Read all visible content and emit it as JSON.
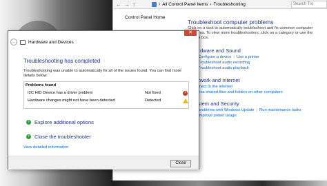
{
  "control_panel": {
    "address_path": [
      "All Control Panel Items",
      "Troubleshooting"
    ],
    "search_placeholder": "Search Tro",
    "home_link": "Control Panel Home",
    "title": "Troubleshoot computer problems",
    "description": "Click on a task to automatically troubleshoot and fix common computer problems. To view more troubleshooters, click on a category or use the Search box.",
    "sections": [
      {
        "title": "Hardware and Sound",
        "icon_color": "#5a8f2e",
        "rows": [
          [
            "Configure a device",
            "Use a printer"
          ],
          [
            "Troubleshoot audio recording"
          ],
          [
            "Troubleshoot audio playback"
          ]
        ]
      },
      {
        "title": "Network and Internet",
        "icon_color": "#2f6fc2",
        "rows": [
          [
            "Connect to the Internet"
          ],
          [
            "Access shared files and folders on other computers"
          ]
        ]
      },
      {
        "title": "System and Security",
        "icon_color": "#3b73d6",
        "rows": [
          [
            "Fix problems with Windows Update",
            "Run maintenance tasks"
          ],
          [
            "Improve power usage"
          ]
        ]
      }
    ]
  },
  "dialog": {
    "close_glyph": "✕",
    "back_glyph": "←",
    "nav_title": "Hardware and Devices",
    "heading": "Troubleshooting has completed",
    "text": "Troubleshooting was unable to automatically fix all of the issues found. You can find more details below.",
    "problems_header": "Problems found",
    "problems": [
      {
        "name": "I2C HID Device has a driver problem",
        "status": "Not fixed",
        "icon": "error-icon"
      },
      {
        "name": "Hardware changes might not have been detected",
        "status": "Detected",
        "icon": "warning-icon"
      }
    ],
    "options": [
      "Explore additional options",
      "Close the troubleshooter"
    ],
    "view_info": "View detailed information",
    "close_button": "Close"
  },
  "colors": {
    "link": "#0066cc",
    "heading": "#1e3287",
    "close_red": "#c74a3a"
  }
}
